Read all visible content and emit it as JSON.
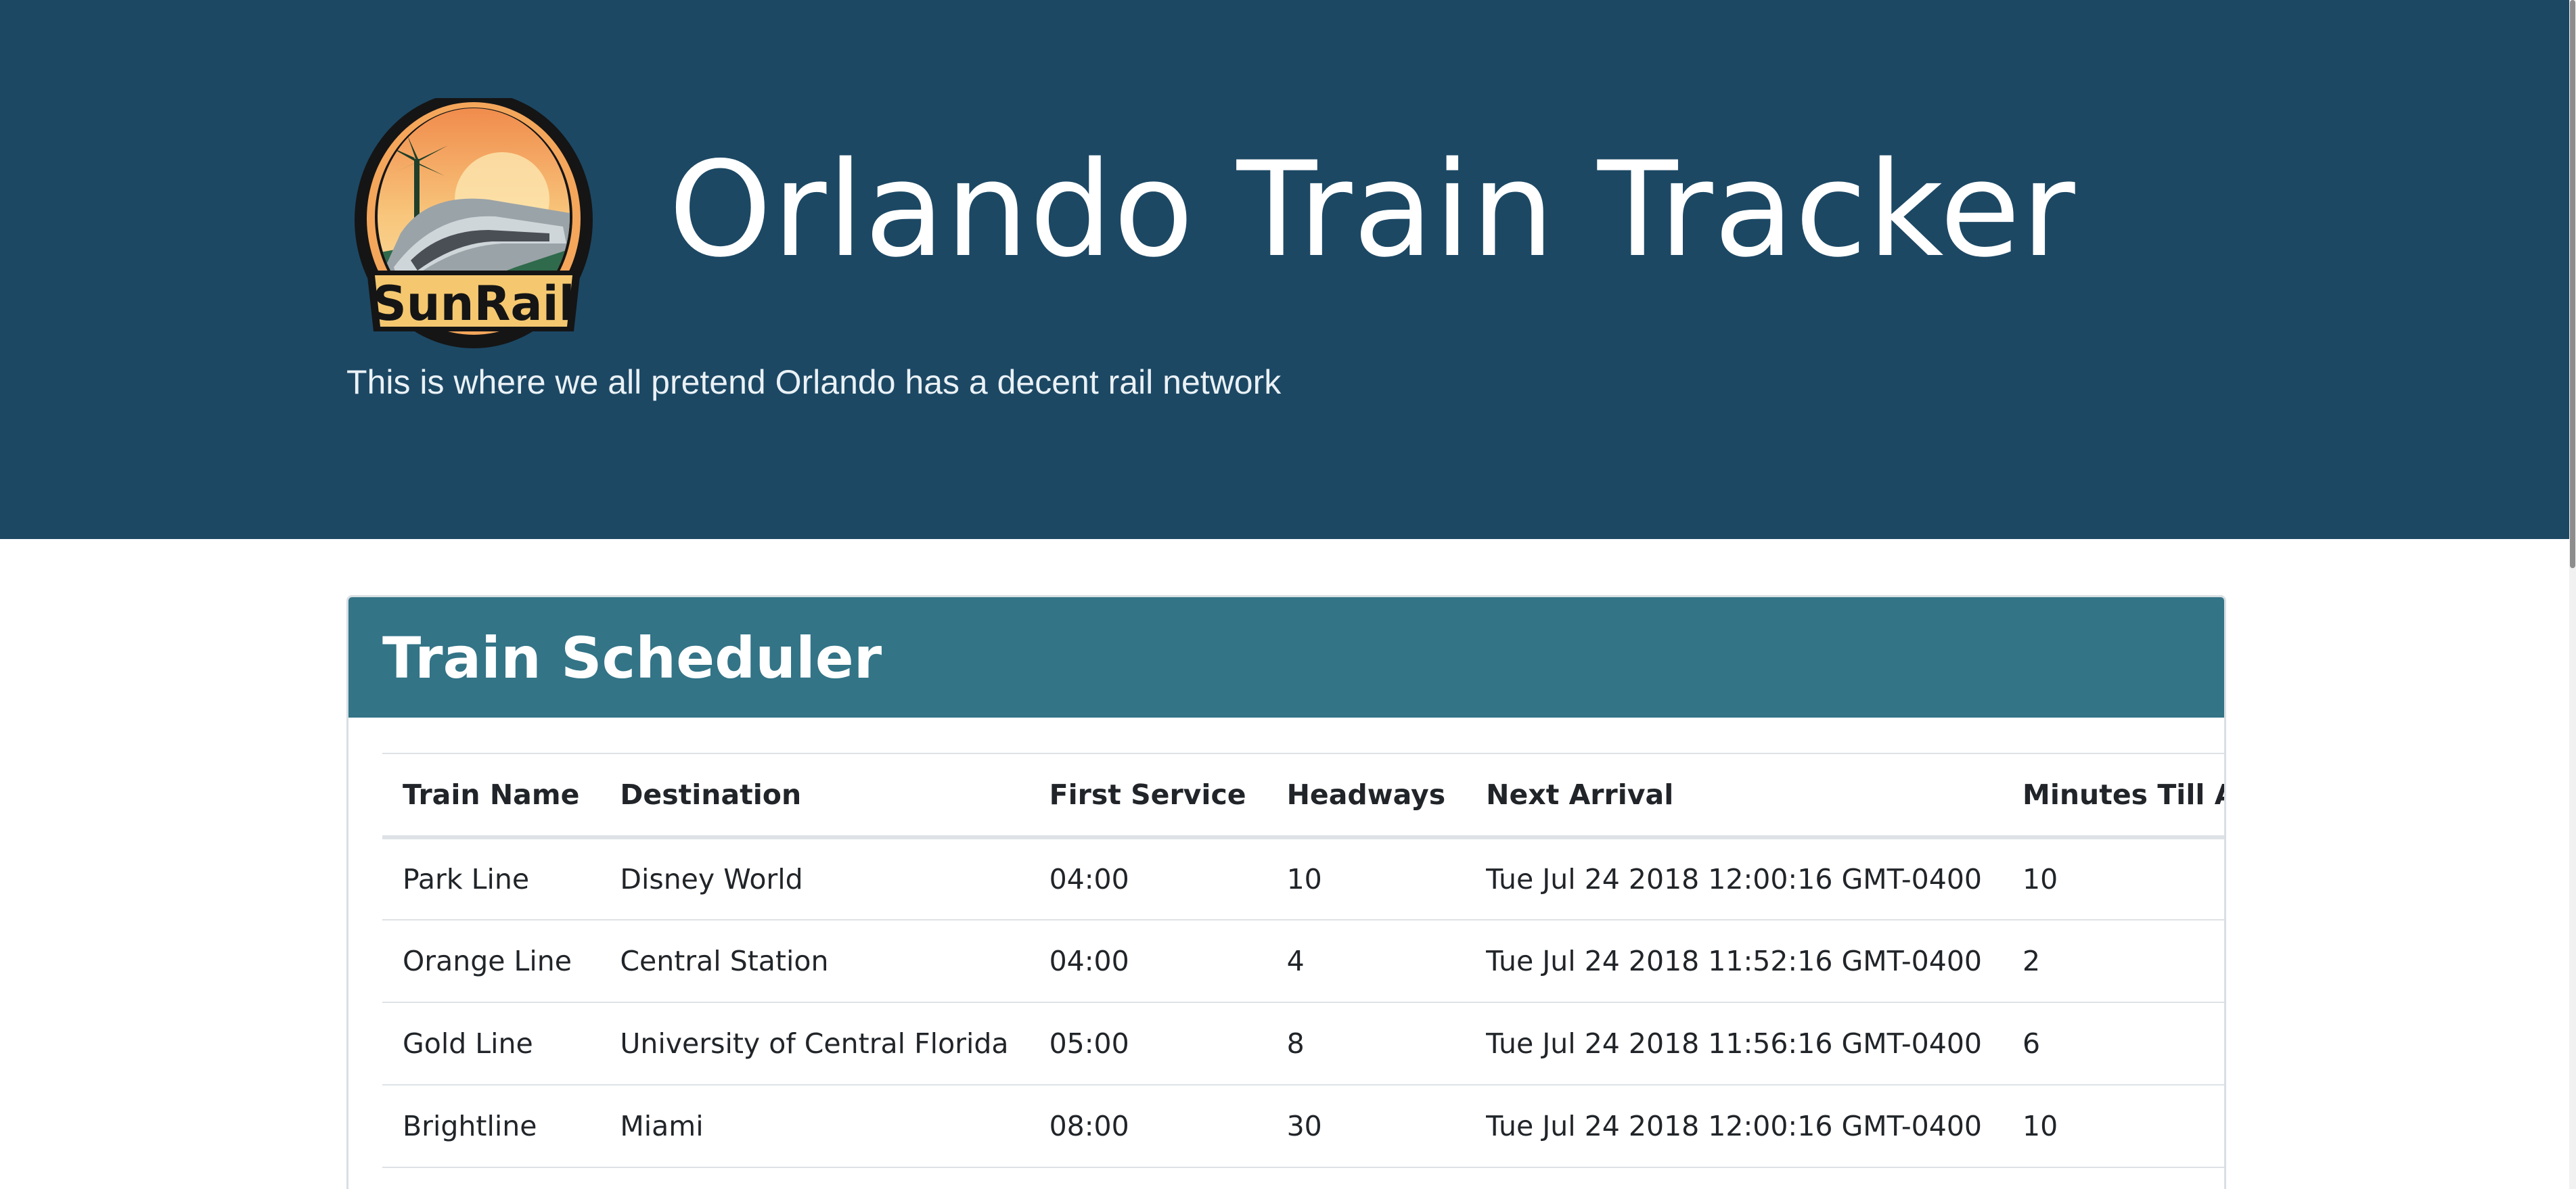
{
  "header": {
    "title": "Orlando Train Tracker",
    "tagline": "This is where we all pretend Orlando has a decent rail network",
    "logo": {
      "text": "SunRail",
      "colors": {
        "ring_outer": "#1a1a1a",
        "ring_inner": "#f4a65b",
        "sky": "#f8c67c",
        "water": "#7cc7c4",
        "banner": "#f5c870"
      }
    },
    "background_color": "#1c4864"
  },
  "scheduler": {
    "title": "Train Scheduler",
    "header_color": "#337487",
    "columns": [
      "Train Name",
      "Destination",
      "First Service",
      "Headways",
      "Next Arrival",
      "Minutes Till Arrival"
    ],
    "rows": [
      [
        "Park Line",
        "Disney World",
        "04:00",
        "10",
        "Tue Jul 24 2018 12:00:16 GMT-0400",
        "10"
      ],
      [
        "Orange Line",
        "Central Station",
        "04:00",
        "4",
        "Tue Jul 24 2018 11:52:16 GMT-0400",
        "2"
      ],
      [
        "Gold Line",
        "University of Central Florida",
        "05:00",
        "8",
        "Tue Jul 24 2018 11:56:16 GMT-0400",
        "6"
      ],
      [
        "Brightline",
        "Miami",
        "08:00",
        "30",
        "Tue Jul 24 2018 12:00:16 GMT-0400",
        "10"
      ]
    ]
  }
}
